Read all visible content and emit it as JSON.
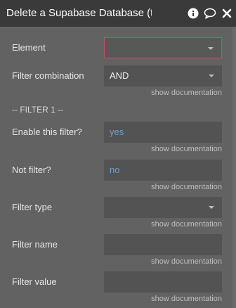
{
  "window": {
    "title": "Delete a Supabase Database (te",
    "icons": [
      "info-icon",
      "comment-icon",
      "close-icon"
    ]
  },
  "fields": {
    "element": {
      "label": "Element",
      "value": ""
    },
    "filter_combination": {
      "label": "Filter combination",
      "value": "AND"
    },
    "filter_section": "-- FILTER 1 --",
    "enable_filter": {
      "label": "Enable this filter?",
      "value": "yes"
    },
    "not_filter": {
      "label": "Not filter?",
      "value": "no"
    },
    "filter_type": {
      "label": "Filter type",
      "value": ""
    },
    "filter_name": {
      "label": "Filter name",
      "value": ""
    },
    "filter_value": {
      "label": "Filter value",
      "value": ""
    }
  },
  "doc_link": "show documentation",
  "colors": {
    "panel_bg": "#626262",
    "titlebar_bg": "#3a3a3a",
    "field_bg": "#535353",
    "error_border": "#d3495f",
    "link_value": "#6e9fd8"
  }
}
